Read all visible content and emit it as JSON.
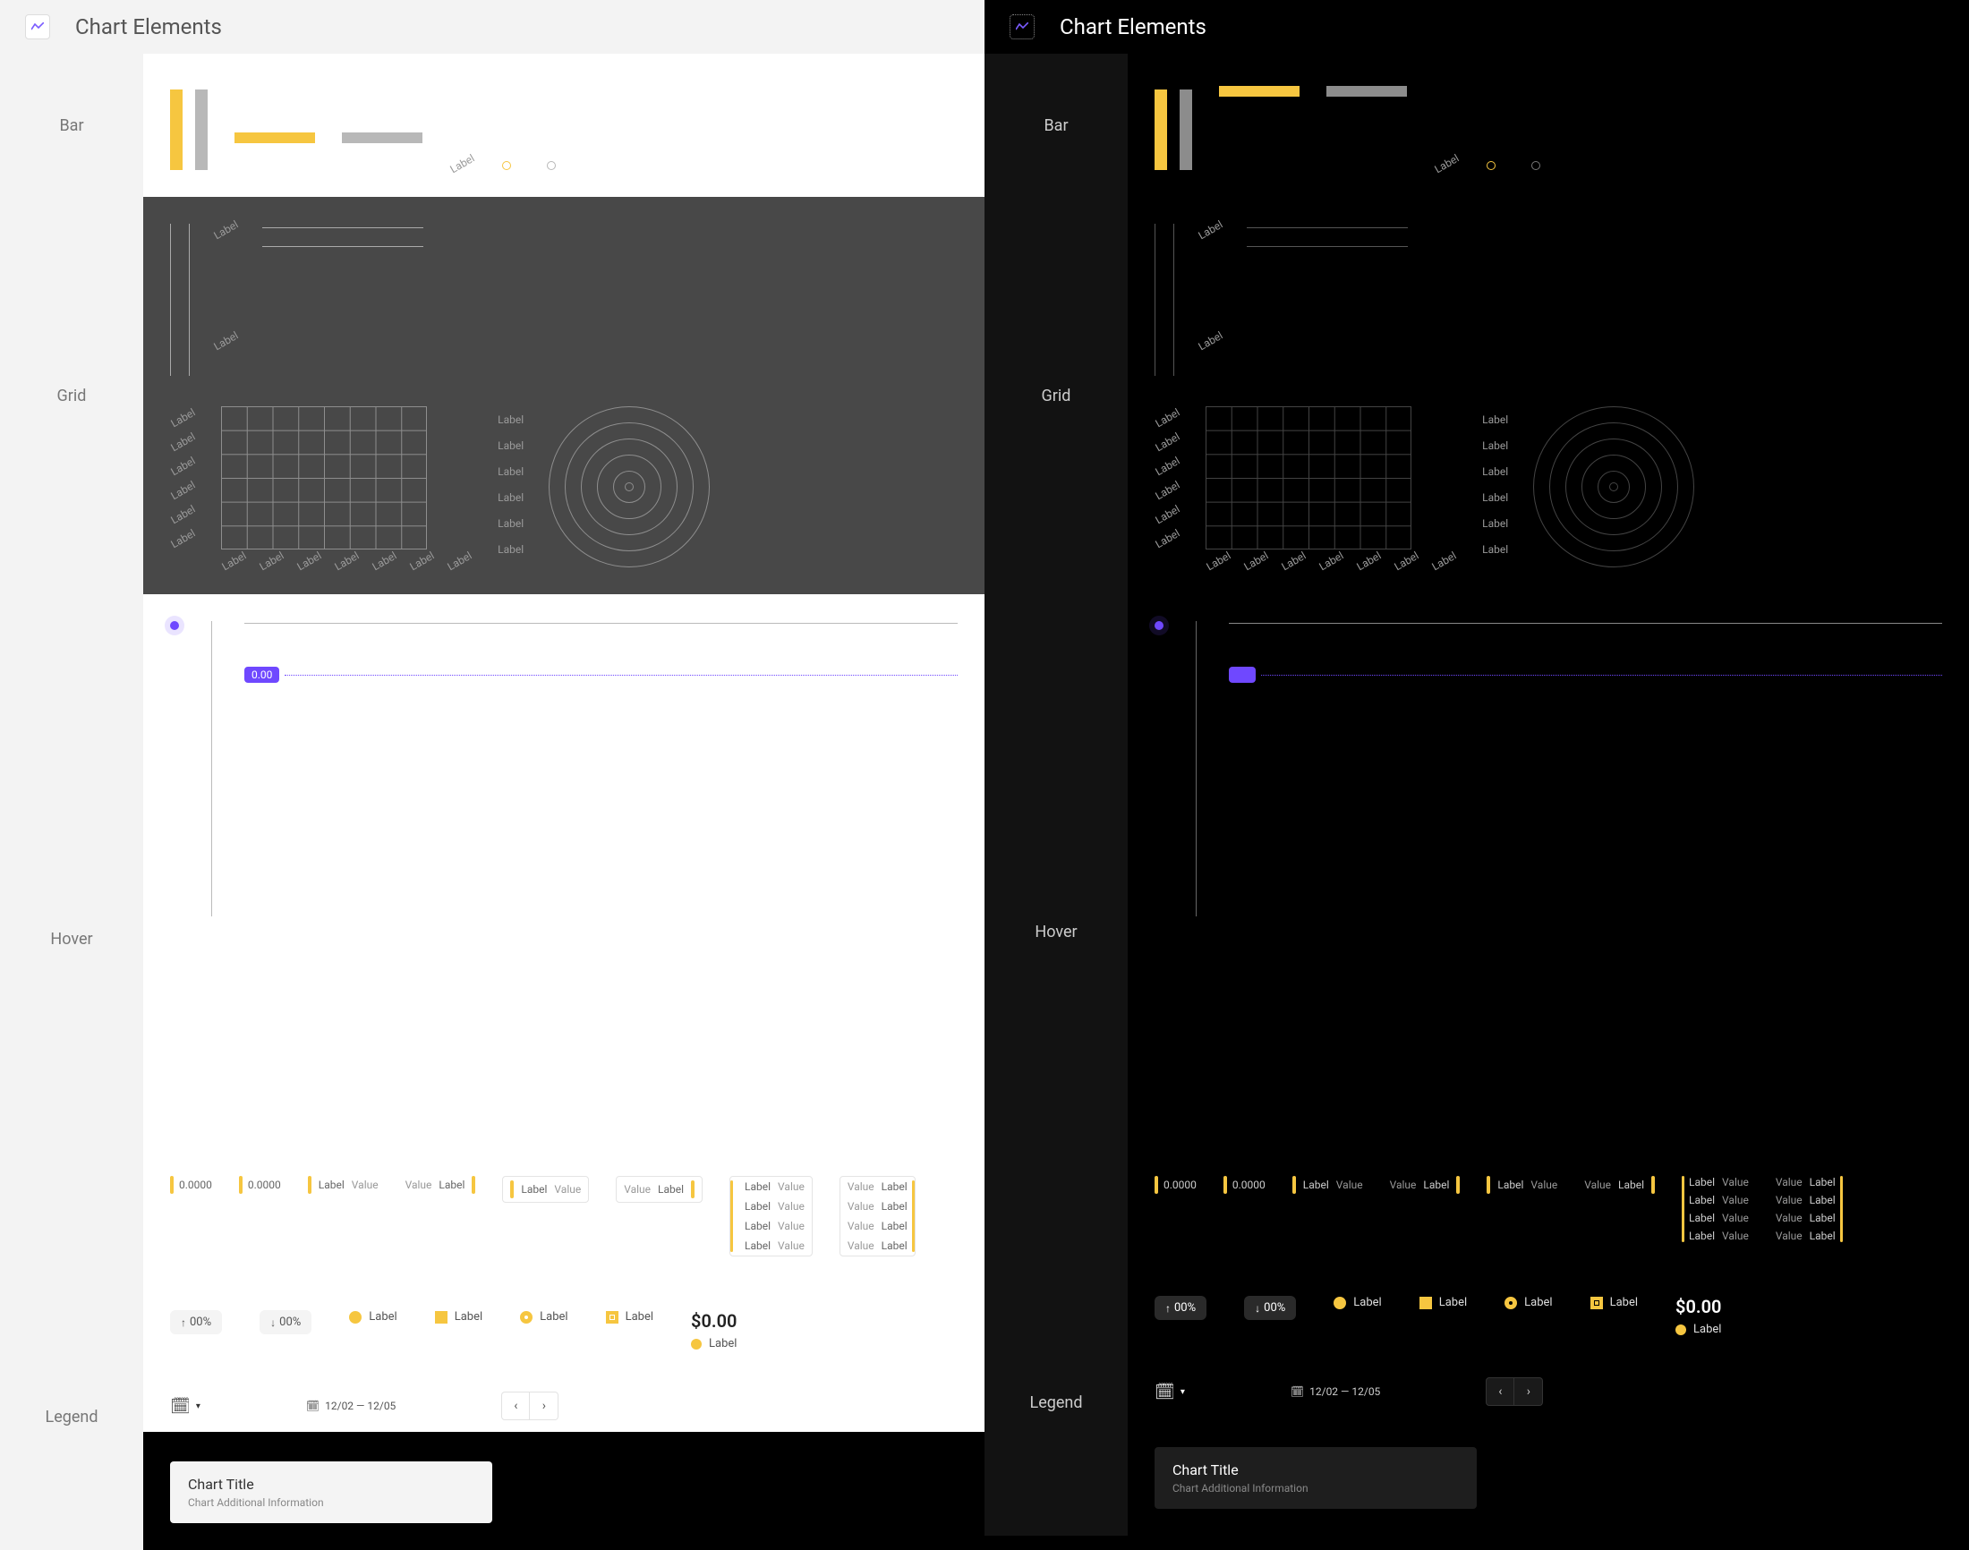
{
  "header": {
    "title": "Chart Elements"
  },
  "sections": {
    "bar": "Bar",
    "bar_dark": "Bar",
    "grid": "Grid",
    "hover": "Hover",
    "legend": "Legend"
  },
  "colors": {
    "accent_yellow": "#f6c640",
    "accent_purple": "#6f48ff",
    "grey": "#b8b8b8"
  },
  "grid": {
    "axis_label": "Label",
    "x_labels": [
      "Label",
      "Label",
      "Label",
      "Label",
      "Label",
      "Label",
      "Label"
    ],
    "y_labels": [
      "Label",
      "Label",
      "Label",
      "Label",
      "Label",
      "Label"
    ],
    "right_labels": [
      "Label",
      "Label",
      "Label",
      "Label",
      "Label",
      "Label"
    ]
  },
  "hover": {
    "badge_value": "0.00",
    "ticks": [
      "0.0000",
      "0.0000"
    ],
    "pair_label": "Label",
    "pair_value": "Value",
    "stack_rows": [
      {
        "label": "Label",
        "value": "Value"
      },
      {
        "label": "Label",
        "value": "Value"
      },
      {
        "label": "Label",
        "value": "Value"
      },
      {
        "label": "Label",
        "value": "Value"
      }
    ]
  },
  "legend": {
    "pct_up": "00%",
    "pct_down": "00%",
    "item_label": "Label",
    "price": "$0.00",
    "date_range": "12/02 — 12/05",
    "title": "Chart Title",
    "subtitle": "Chart Additional Information"
  }
}
